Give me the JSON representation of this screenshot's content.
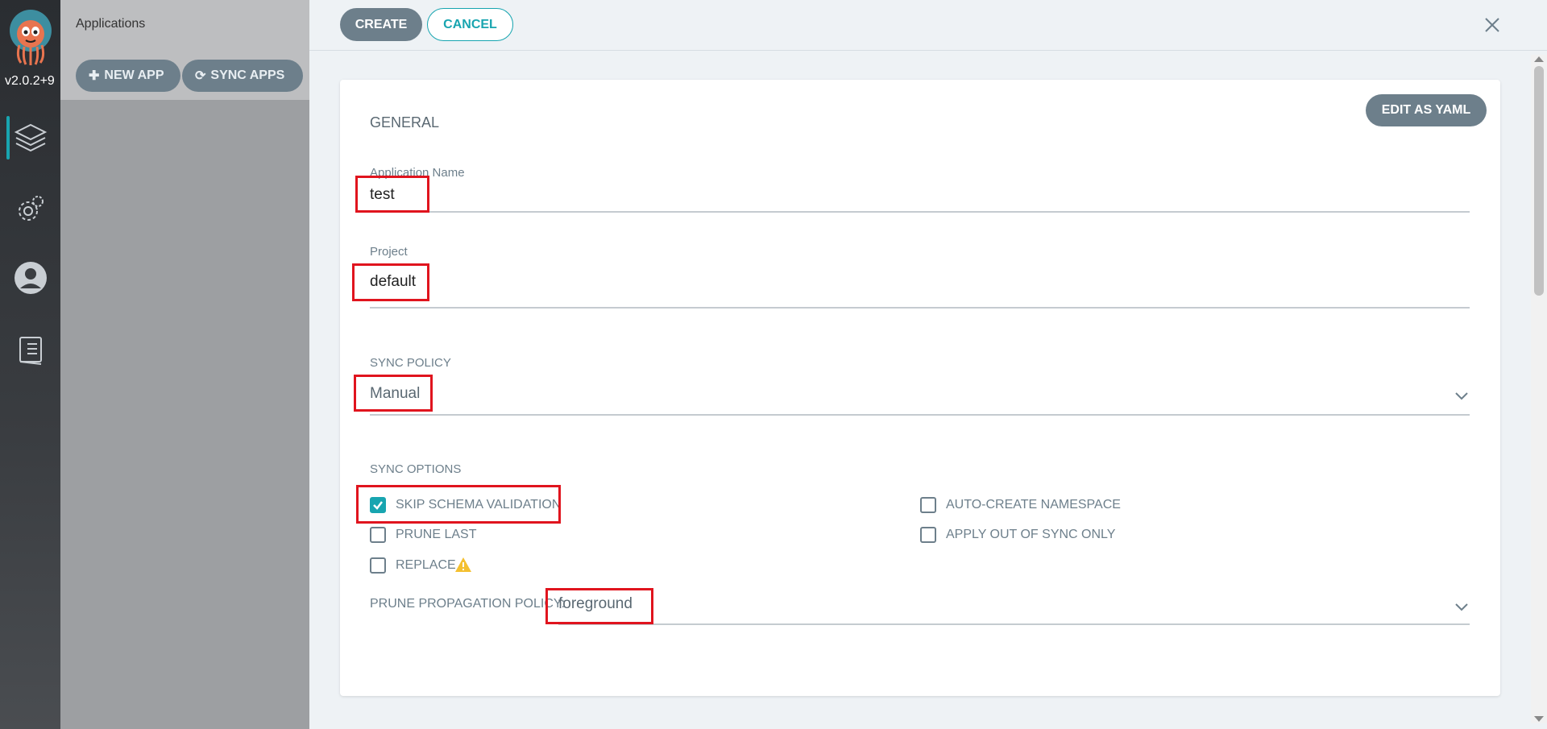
{
  "nav": {
    "version": "v2.0.2+9",
    "items": [
      {
        "icon": "layers-icon",
        "active": true
      },
      {
        "icon": "gear-icon",
        "active": false
      },
      {
        "icon": "user-icon",
        "active": false
      },
      {
        "icon": "docs-icon",
        "active": false
      }
    ]
  },
  "applications_panel": {
    "title": "Applications",
    "new_app_label": "NEW APP",
    "sync_apps_label": "SYNC APPS"
  },
  "toolbar": {
    "create_label": "CREATE",
    "cancel_label": "CANCEL"
  },
  "form": {
    "edit_yaml_label": "EDIT AS YAML",
    "general_title": "GENERAL",
    "app_name": {
      "label": "Application Name",
      "value": "test"
    },
    "project": {
      "label": "Project",
      "value": "default"
    },
    "sync_policy": {
      "label": "SYNC POLICY",
      "value": "Manual"
    },
    "sync_options": {
      "title": "SYNC OPTIONS",
      "skip_schema_validation": {
        "label": "SKIP SCHEMA VALIDATION",
        "checked": true
      },
      "prune_last": {
        "label": "PRUNE LAST",
        "checked": false
      },
      "replace": {
        "label": "REPLACE",
        "checked": false
      },
      "auto_create_namespace": {
        "label": "AUTO-CREATE NAMESPACE",
        "checked": false
      },
      "apply_out_of_sync_only": {
        "label": "APPLY OUT OF SYNC ONLY",
        "checked": false
      }
    },
    "prune_propagation_policy": {
      "label": "PRUNE PROPAGATION POLICY:",
      "value": "foreground"
    }
  },
  "colors": {
    "accent": "#18a5b0",
    "button": "#6d7f8b",
    "highlight": "#e0141e",
    "warning": "#f4c030"
  }
}
